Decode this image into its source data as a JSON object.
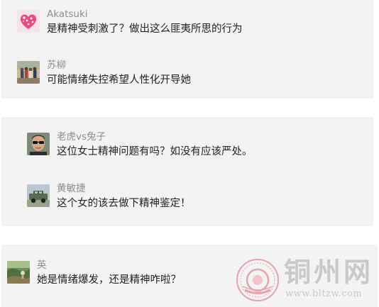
{
  "comment_groups": [
    {
      "comments": [
        {
          "author": "Akatsuki",
          "avatar": "pink-heart-avatar-icon",
          "text": "是精神受刺激了？做出这么匪夷所思的行为"
        },
        {
          "author": "苏柳",
          "avatar": "group-photo-avatar-icon",
          "text": "可能情绪失控希望人性化开导她"
        }
      ]
    },
    {
      "comments": [
        {
          "author": "老虎vs兔子",
          "avatar": "man-sunglasses-avatar-icon",
          "text": "这位女士精神问题有吗？如没有应该严处。"
        },
        {
          "author": "黄敏捷",
          "avatar": "vehicle-avatar-icon",
          "text": "这个女的该去做下精神鉴定！"
        }
      ]
    },
    {
      "comments": [
        {
          "author": "英",
          "avatar": "landscape-avatar-icon",
          "text": "她是情绪爆发，还是精神咋啦？"
        }
      ]
    }
  ],
  "watermark": {
    "site_name": "铜州网",
    "url": "www.bltzw.com",
    "logo": "seal-logo-icon"
  },
  "colors": {
    "panel_background": "#f3f3f3",
    "author_text": "#8d8d8d",
    "comment_text": "#222222",
    "watermark": "#c9c9c9"
  }
}
